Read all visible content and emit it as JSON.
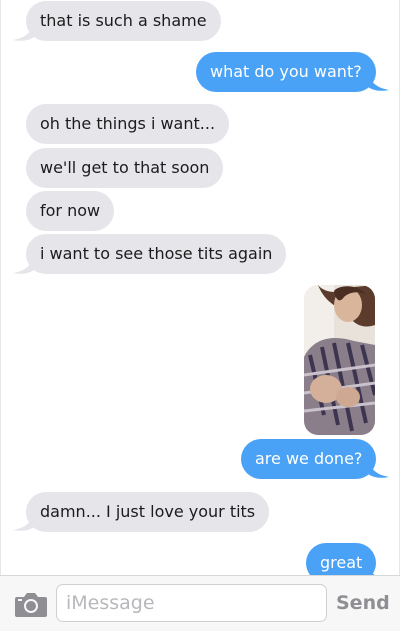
{
  "messages": [
    {
      "from": "them",
      "text": "that is such a shame"
    },
    {
      "from": "me",
      "text": "what do you want?"
    },
    {
      "from": "them",
      "text": "oh the things i want..."
    },
    {
      "from": "them",
      "text": "we'll get to that soon"
    },
    {
      "from": "them",
      "text": "for now"
    },
    {
      "from": "them",
      "text": "i want to see those tits again"
    },
    {
      "from": "me",
      "type": "photo"
    },
    {
      "from": "me",
      "text": "are we done?"
    },
    {
      "from": "them",
      "text": "damn... I just love your tits"
    },
    {
      "from": "me",
      "text": "great"
    }
  ],
  "composer": {
    "placeholder": "iMessage",
    "send_label": "Send"
  },
  "colors": {
    "sent_bubble": "#4aa2f7",
    "received_bubble": "#e5e5ea",
    "background": "#ffffff"
  },
  "icons": {
    "camera": "camera-icon"
  }
}
